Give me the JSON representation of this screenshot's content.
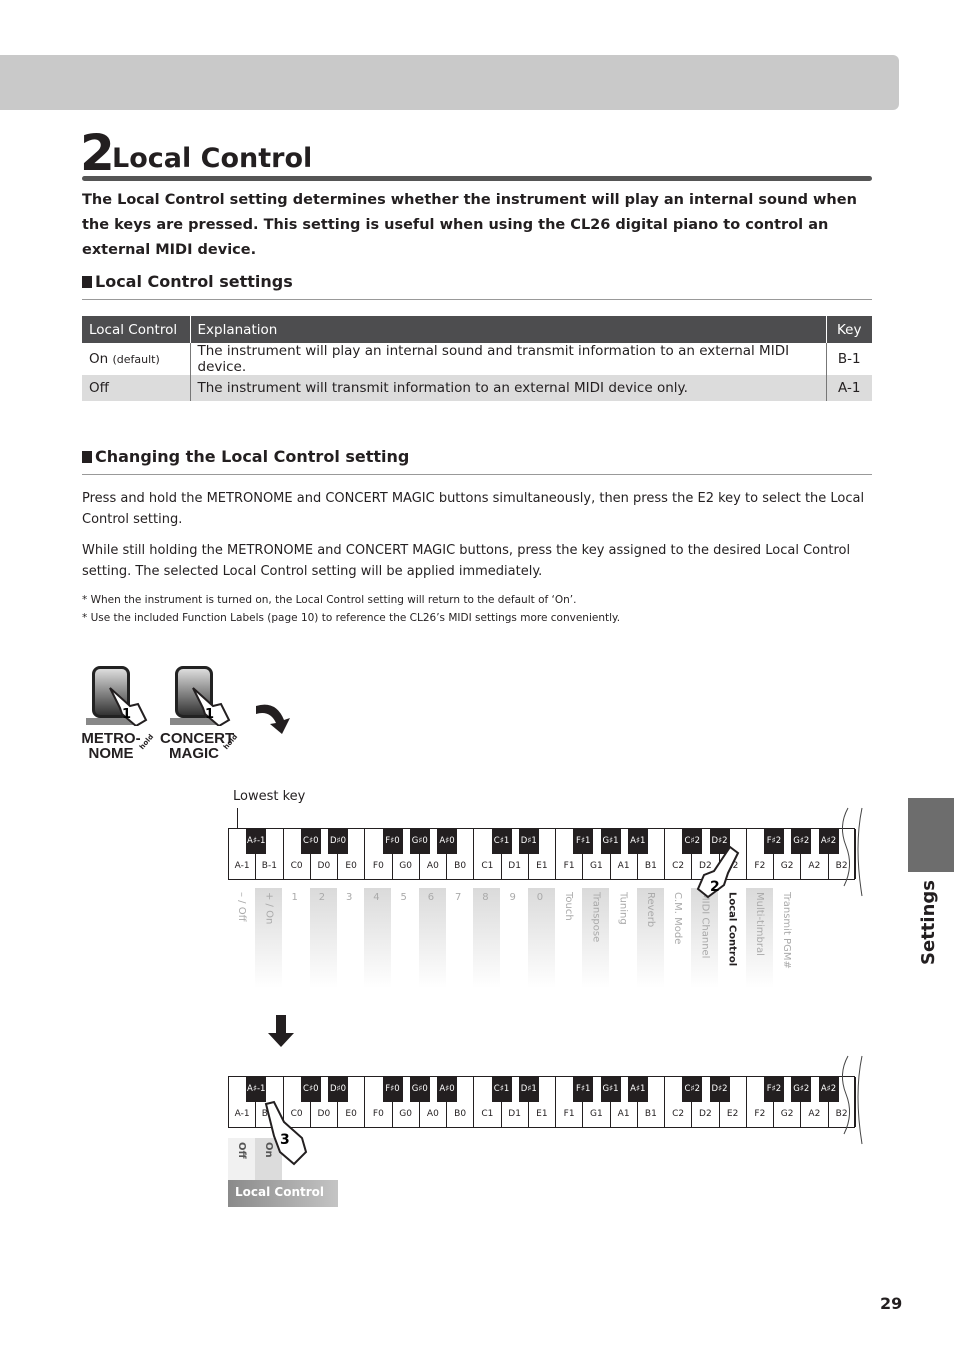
{
  "section_number": "2",
  "title": "Local Control",
  "intro": "The Local Control setting determines whether the instrument will play an internal sound when the keys are pressed.  This setting is useful when using the CL26 digital piano to control an external MIDI device.",
  "settings_heading": "Local Control settings",
  "table": {
    "headers": [
      "Local Control",
      "Explanation",
      "Key"
    ],
    "rows": [
      {
        "setting": "On",
        "note": "(default)",
        "explanation": "The instrument will play an internal sound and transmit information to an external MIDI device.",
        "key": "B-1"
      },
      {
        "setting": "Off",
        "note": "",
        "explanation": "The instrument will transmit information to an external MIDI device only.",
        "key": "A-1"
      }
    ]
  },
  "changing_heading": "Changing the Local Control setting",
  "para1": "Press and hold the METRONOME and CONCERT MAGIC buttons simultaneously, then press the E2 key to select the Local Control setting.",
  "para2": "While still holding the METRONOME and CONCERT MAGIC buttons, press the key assigned to the desired Local Control setting. The selected Local Control setting will be applied immediately.",
  "note1": "* When the instrument is turned on, the Local Control setting will return to the default of ‘On’.",
  "note2": "* Use the included Function Labels (page 10) to reference the CL26’s MIDI settings more conveniently.",
  "buttons": [
    {
      "label1": "METRO-",
      "label2": "NOME",
      "finger": "1",
      "hold": "hold"
    },
    {
      "label1": "CONCERT",
      "label2": "MAGIC",
      "finger": "1",
      "hold": "hold"
    }
  ],
  "lowest_key": "Lowest key",
  "white_keys": [
    "A-1",
    "B-1",
    "C0",
    "D0",
    "E0",
    "F0",
    "G0",
    "A0",
    "B0",
    "C1",
    "D1",
    "E1",
    "F1",
    "G1",
    "A1",
    "B1",
    "C2",
    "D2",
    "E2",
    "F2",
    "G2",
    "A2",
    "B2"
  ],
  "black_keys": [
    {
      "label": "A♯-1",
      "after": 1
    },
    {
      "label": "C♯0",
      "after": 3
    },
    {
      "label": "D♯0",
      "after": 4
    },
    {
      "label": "F♯0",
      "after": 6
    },
    {
      "label": "G♯0",
      "after": 7
    },
    {
      "label": "A♯0",
      "after": 8
    },
    {
      "label": "C♯1",
      "after": 10
    },
    {
      "label": "D♯1",
      "after": 11
    },
    {
      "label": "F♯1",
      "after": 13
    },
    {
      "label": "G♯1",
      "after": 14
    },
    {
      "label": "A♯1",
      "after": 15
    },
    {
      "label": "C♯2",
      "after": 17
    },
    {
      "label": "D♯2",
      "after": 18
    },
    {
      "label": "F♯2",
      "after": 20
    },
    {
      "label": "G♯2",
      "after": 21
    },
    {
      "label": "A♯2",
      "after": 22
    }
  ],
  "function_labels": [
    "– / Off",
    "+ / On",
    "1",
    "2",
    "3",
    "4",
    "5",
    "6",
    "7",
    "8",
    "9",
    "0",
    "Touch",
    "Transpose",
    "Tuning",
    "Reverb",
    "C.M. Mode",
    "MIDI Channel",
    "Local Control",
    "Multi-timbral",
    "Transmit PGM#"
  ],
  "selected_function": "Local Control",
  "step2_finger": "2",
  "step3_finger": "3",
  "lower_labels": [
    "Off",
    "On"
  ],
  "lower_caption": "Local Control",
  "side_tab": "Settings",
  "page_number": "29",
  "colors": {
    "header_bar": "#c9c9c9",
    "table_header": "#4d4d4f",
    "side_tab": "#6d6d6d"
  }
}
